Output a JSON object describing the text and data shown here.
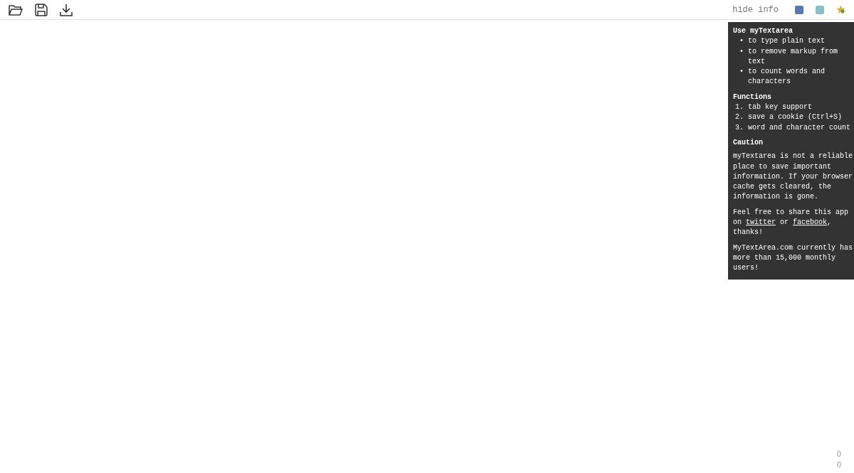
{
  "toolbar": {
    "hide_info": "hide info"
  },
  "info": {
    "title": "Use myTextarea",
    "uses": [
      {
        "marker": "•",
        "text": "to type plain text"
      },
      {
        "marker": "•",
        "text": "to remove markup from text"
      },
      {
        "marker": "•",
        "text": "to count words and characters"
      }
    ],
    "functions_title": "Functions",
    "functions": [
      {
        "marker": "1.",
        "text": "tab key support"
      },
      {
        "marker": "2.",
        "text": "save a cookie (Ctrl+S)"
      },
      {
        "marker": "3.",
        "text": "word and character count"
      }
    ],
    "caution_title": "Caution",
    "caution": "myTextarea is not a reliable place to save important information. If your browser cache gets cleared, the information is gone.",
    "share": {
      "before": "Feel free to share this app on",
      "twitter": "twitter",
      "middle": "or",
      "facebook": "facebook",
      "after": ", thanks!"
    },
    "users": "MyTextArea.com currently has more than 15,000 monthly users!"
  },
  "counts": {
    "words": "0",
    "characters": "0"
  }
}
